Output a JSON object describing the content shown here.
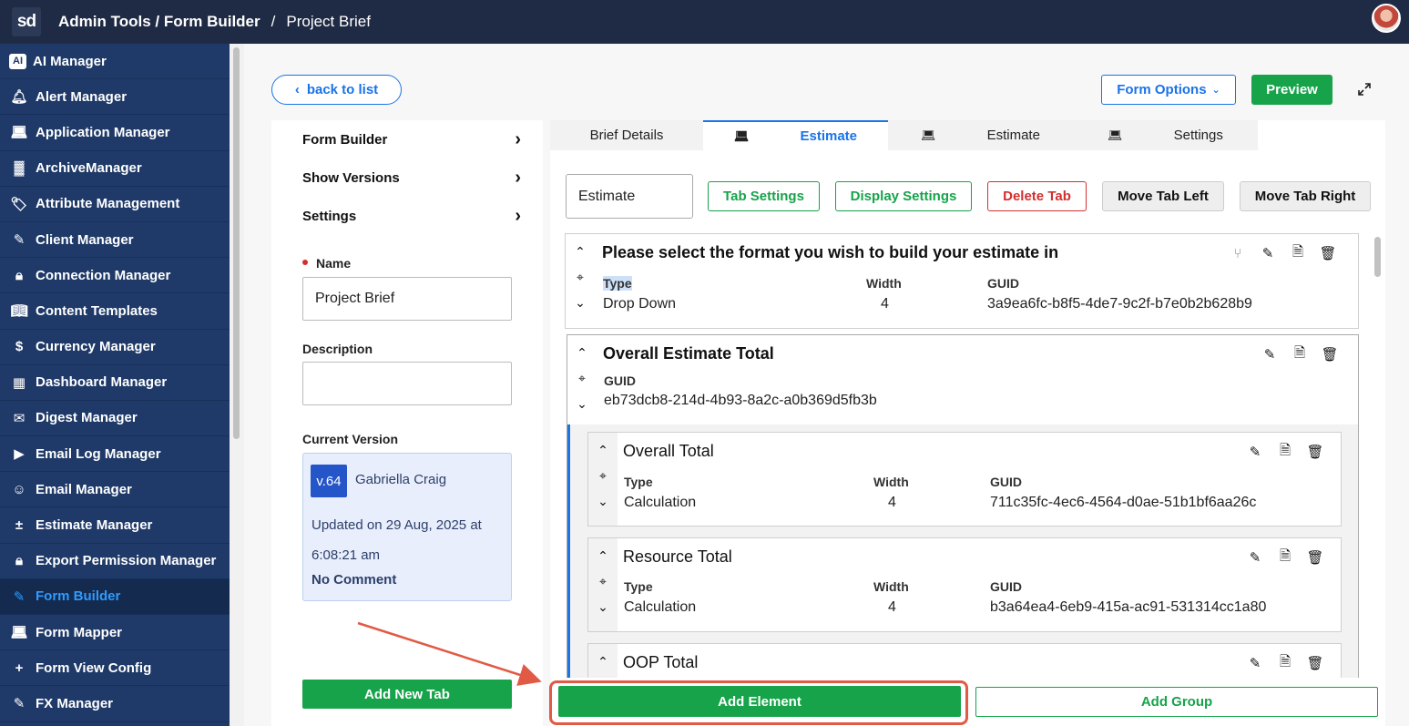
{
  "header": {
    "logo_text": "sd",
    "breadcrumb_main": "Admin Tools / Form Builder",
    "separator": "/",
    "breadcrumb_current": "Project Brief"
  },
  "sidebar": {
    "items": [
      {
        "label": "AI Manager",
        "icon": "ai-icon"
      },
      {
        "label": "Alert Manager",
        "icon": "bell-icon"
      },
      {
        "label": "Application Manager",
        "icon": "laptop-icon"
      },
      {
        "label": "ArchiveManager",
        "icon": "archive-icon"
      },
      {
        "label": "Attribute Management",
        "icon": "tag-icon"
      },
      {
        "label": "Client Manager",
        "icon": "clipboard-edit-icon"
      },
      {
        "label": "Connection Manager",
        "icon": "lock-icon"
      },
      {
        "label": "Content Templates",
        "icon": "book-icon"
      },
      {
        "label": "Currency Manager",
        "icon": "currency-icon"
      },
      {
        "label": "Dashboard Manager",
        "icon": "dashboard-icon"
      },
      {
        "label": "Digest Manager",
        "icon": "mail-open-icon"
      },
      {
        "label": "Email Log Manager",
        "icon": "clipboard-arrow-icon"
      },
      {
        "label": "Email Manager",
        "icon": "clipboard-user-icon"
      },
      {
        "label": "Estimate Manager",
        "icon": "calculator-icon"
      },
      {
        "label": "Export Permission Manager",
        "icon": "lock-icon"
      },
      {
        "label": "Form Builder",
        "icon": "clipboard-edit-icon",
        "active": true
      },
      {
        "label": "Form Mapper",
        "icon": "laptop-icon"
      },
      {
        "label": "Form View Config",
        "icon": "plus-icon"
      },
      {
        "label": "FX Manager",
        "icon": "clipboard-edit-icon"
      }
    ]
  },
  "toolbar": {
    "back_label": "back to list",
    "form_options_label": "Form Options",
    "preview_label": "Preview"
  },
  "left_panel": {
    "nav": [
      {
        "label": "Form Builder"
      },
      {
        "label": "Show Versions"
      },
      {
        "label": "Settings"
      }
    ],
    "name_label": "Name",
    "name_value": "Project Brief",
    "description_label": "Description",
    "description_value": "",
    "current_version_label": "Current Version",
    "version": {
      "badge": "v.64",
      "author": "Gabriella Craig",
      "updated": "Updated on 29 Aug, 2025 at 6:08:21 am",
      "comment": "No Comment"
    },
    "add_tab_label": "Add New Tab"
  },
  "tabs": [
    {
      "label": "Brief Details",
      "active": false,
      "icon": ""
    },
    {
      "label": "Estimate",
      "active": true,
      "icon": "laptop-icon"
    },
    {
      "label": "Estimate",
      "active": false,
      "icon": "laptop-icon"
    },
    {
      "label": "Settings",
      "active": false,
      "icon": "laptop-icon"
    }
  ],
  "tab_controls": {
    "tab_name_value": "Estimate",
    "tab_settings": "Tab Settings",
    "display_settings": "Display Settings",
    "delete_tab": "Delete Tab",
    "move_left": "Move Tab Left",
    "move_right": "Move Tab Right"
  },
  "elements": {
    "field1": {
      "title": "Please select the format you wish to build your estimate in",
      "type_label": "Type",
      "type_value": "Drop Down",
      "width_label": "Width",
      "width_value": "4",
      "guid_label": "GUID",
      "guid_value": "3a9ea6fc-b8f5-4de7-9c2f-b7e0b2b628b9"
    },
    "group": {
      "title": "Overall Estimate Total",
      "guid_label": "GUID",
      "guid_value": "eb73dcb8-214d-4b93-8a2c-a0b369d5fb3b",
      "children": [
        {
          "title": "Overall Total",
          "type_label": "Type",
          "type_value": "Calculation",
          "width_label": "Width",
          "width_value": "4",
          "guid_label": "GUID",
          "guid_value": "711c35fc-4ec6-4564-d0ae-51b1bf6aa26c"
        },
        {
          "title": "Resource Total",
          "type_label": "Type",
          "type_value": "Calculation",
          "width_label": "Width",
          "width_value": "4",
          "guid_label": "GUID",
          "guid_value": "b3a64ea4-6eb9-415a-ac91-531314cc1a80"
        },
        {
          "title": "OOP Total"
        }
      ]
    }
  },
  "bottom": {
    "add_element": "Add Element",
    "add_group": "Add Group"
  },
  "colors": {
    "topbar": "#1f2b44",
    "sidebar": "#1f3a68",
    "accent_blue": "#1a73e8",
    "green": "#16a34a",
    "red": "#d32f2f",
    "annotation": "#e15a45"
  }
}
